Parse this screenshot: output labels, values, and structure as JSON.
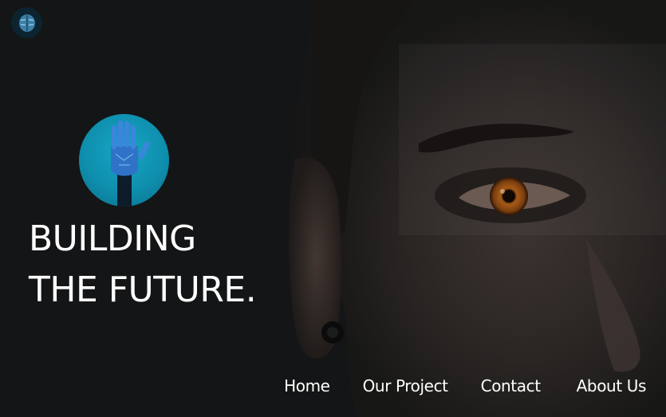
{
  "brand": {
    "logo_icon": "brain-icon"
  },
  "hero": {
    "icon": "robot-hand-icon",
    "headline_line1": "BUILDING",
    "headline_line2": "THE FUTURE.",
    "background_image": "close-up-face-photo"
  },
  "nav": {
    "items": [
      {
        "label": "Home"
      },
      {
        "label": "Our Project"
      },
      {
        "label": "Contact"
      },
      {
        "label": "About Us"
      }
    ]
  },
  "colors": {
    "background": "#141516",
    "accent_circle": "#0f8fae",
    "text": "#ffffff",
    "eye": "#8a4a14"
  }
}
